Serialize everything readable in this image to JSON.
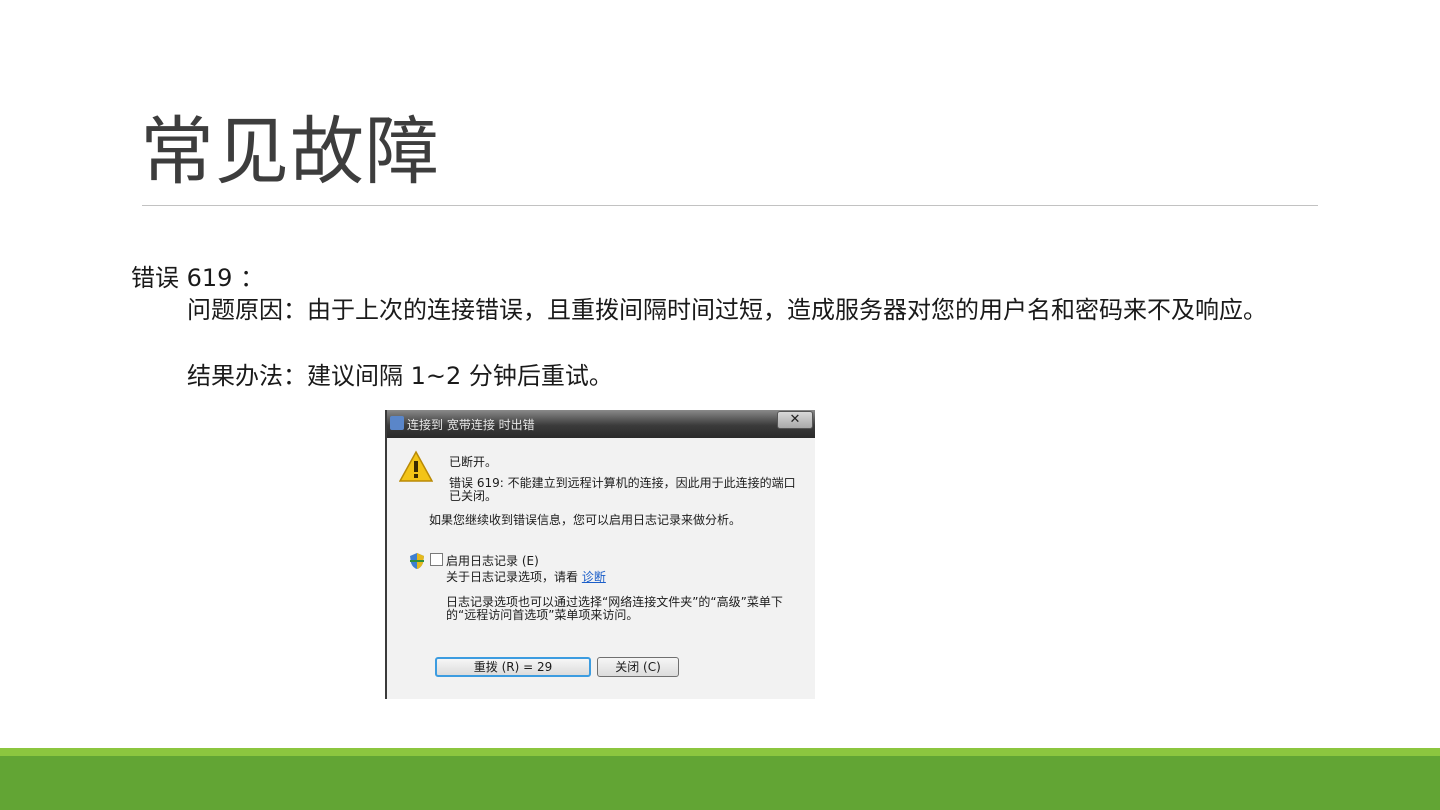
{
  "slide": {
    "title": "常见故障",
    "body": {
      "error_heading": "错误 619 ：",
      "cause": "问题原因：由于上次的连接错误，且重拨间隔时间过短，造成服务器对您的用户名和密码来不及响应。",
      "solution": "结果办法：建议间隔 1~2 分钟后重试。"
    }
  },
  "dialog": {
    "title": "连接到 宽带连接 时出错",
    "close_glyph": "✕",
    "status": "已断开。",
    "error_message": "错误 619: 不能建立到远程计算机的连接，因此用于此连接的端口已关闭。",
    "info": "如果您继续收到错误信息，您可以启用日志记录来做分析。",
    "enable_logging_label": "启用日志记录 (E)",
    "about_logging_prefix": "关于日志记录选项，请看",
    "diagnose_link": "诊断",
    "note": "日志记录选项也可以通过选择“网络连接文件夹”的“高级”菜单下的“远程访问首选项”菜单项来访问。",
    "redial_button": "重拨 (R) = 29",
    "close_button": "关闭 (C)"
  },
  "colors": {
    "footer_primary": "#62a534",
    "footer_accent": "#8cc63f",
    "title_text": "#3d3d3d"
  }
}
